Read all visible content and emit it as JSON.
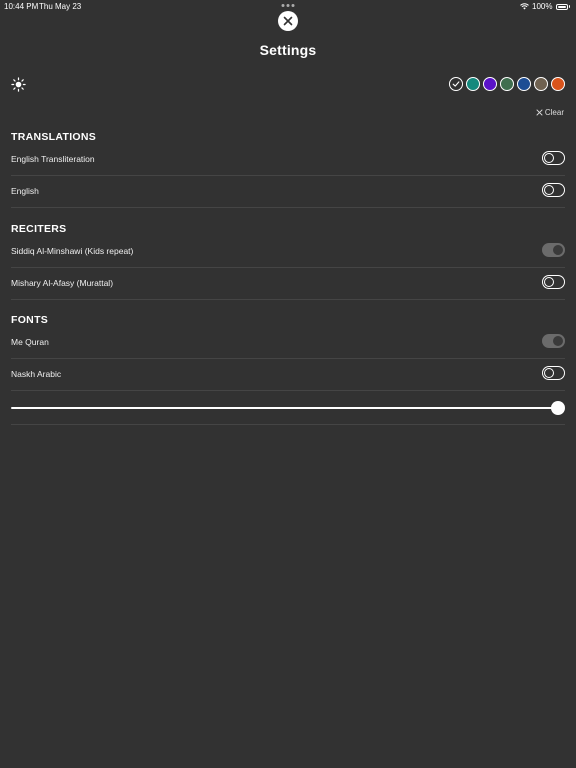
{
  "status_bar": {
    "time": "10:44 PM",
    "date": "Thu May 23",
    "battery": "100%"
  },
  "header": {
    "title": "Settings"
  },
  "theme": {
    "icon": "sun-icon",
    "swatches": [
      {
        "color": "#323232",
        "selected": true
      },
      {
        "color": "#14897d",
        "selected": false
      },
      {
        "color": "#5a12c8",
        "selected": false
      },
      {
        "color": "#3f6e4f",
        "selected": false
      },
      {
        "color": "#1d4d94",
        "selected": false
      },
      {
        "color": "#6f6150",
        "selected": false
      },
      {
        "color": "#d9541c",
        "selected": false
      }
    ]
  },
  "clear_label": "Clear",
  "sections": {
    "translations": {
      "title": "TRANSLATIONS",
      "items": [
        {
          "label": "English Transliteration",
          "on": false
        },
        {
          "label": "English",
          "on": false
        }
      ]
    },
    "reciters": {
      "title": "RECITERS",
      "items": [
        {
          "label": "Siddiq Al-Minshawi (Kids repeat)",
          "on": true
        },
        {
          "label": "Mishary Al-Afasy (Murattal)",
          "on": false
        }
      ]
    },
    "fonts": {
      "title": "FONTS",
      "items": [
        {
          "label": "Me Quran",
          "on": true
        },
        {
          "label": "Naskh Arabic",
          "on": false
        }
      ]
    }
  },
  "font_size_slider": {
    "value": 1.0
  }
}
